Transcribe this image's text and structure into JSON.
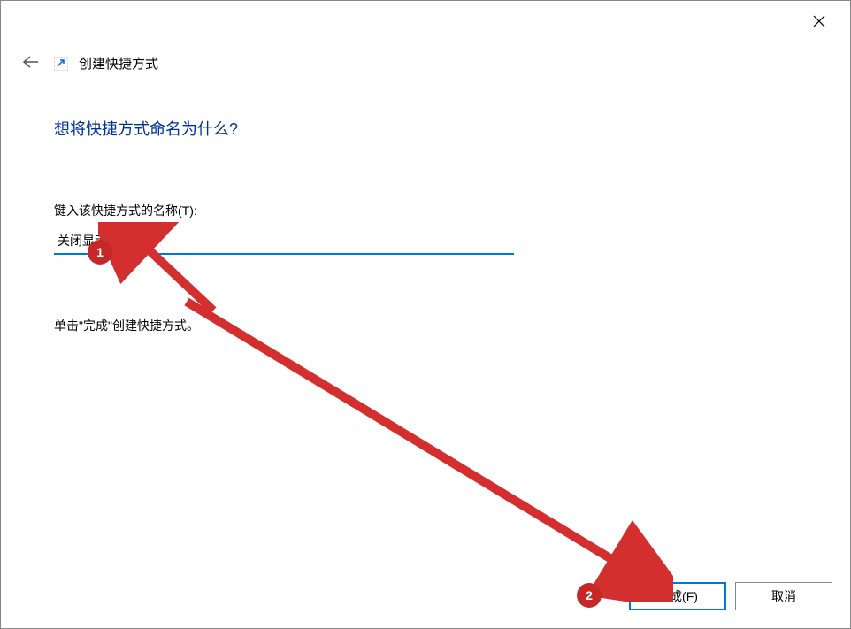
{
  "window": {
    "title": "创建快捷方式"
  },
  "content": {
    "heading": "想将快捷方式命名为什么?",
    "input_label": "键入该快捷方式的名称(T):",
    "input_value": "关闭显示器",
    "hint": "单击\"完成\"创建快捷方式。"
  },
  "footer": {
    "finish_label": "完成(F)",
    "cancel_label": "取消"
  },
  "annotations": {
    "badge1": "1",
    "badge2": "2"
  }
}
